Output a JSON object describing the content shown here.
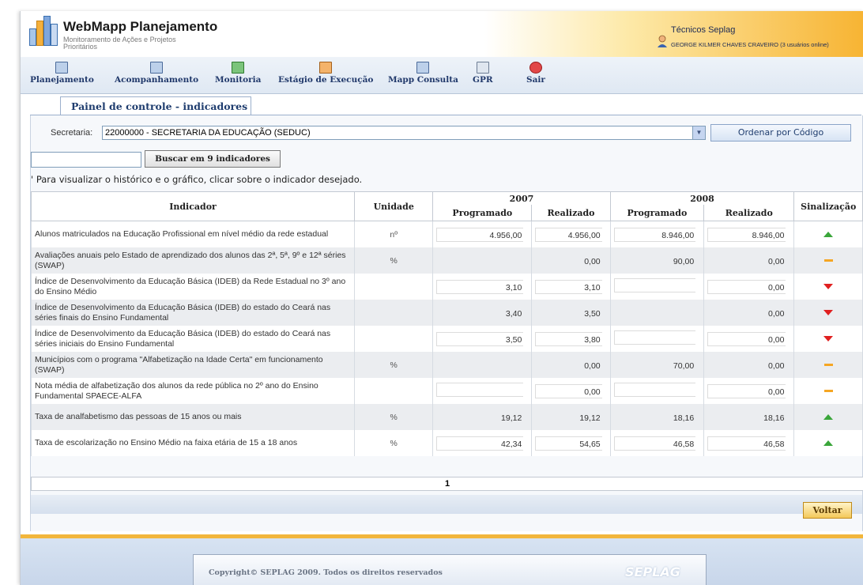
{
  "header": {
    "app_title": "WebMapp Planejamento",
    "app_subtitle": "Monitoramento de Ações e Projetos Prioritários",
    "user_role": "Técnicos Seplag",
    "user_name": "GEORGE KILMER CHAVES CRAVEIRO (3 usuários online)"
  },
  "nav": [
    {
      "label": "Planejamento",
      "icon": "planning-icon"
    },
    {
      "label": "Acompanhamento",
      "icon": "tracking-icon"
    },
    {
      "label": "Monitoria",
      "icon": "monitoring-icon"
    },
    {
      "label": "Estágio de Execução",
      "icon": "execution-icon"
    },
    {
      "label": "Mapp Consulta",
      "icon": "consult-icon"
    },
    {
      "label": "GPR",
      "icon": "gpr-icon"
    },
    {
      "label": "Sair",
      "icon": "exit-icon"
    }
  ],
  "tab": {
    "label": "Painel de controle - indicadores"
  },
  "filter": {
    "secretaria_label": "Secretaria:",
    "secretaria_value": "22000000 - SECRETARIA DA EDUCAÇÃO (SEDUC)",
    "order_button": "Ordenar por Código",
    "search_value": "",
    "search_button": "Buscar em 9 indicadores",
    "hint": "' Para visualizar o histórico e o gráfico, clicar sobre o indicador desejado."
  },
  "table": {
    "headers": {
      "indicador": "Indicador",
      "unidade": "Unidade",
      "year1": "2007",
      "year2": "2008",
      "programado": "Programado",
      "realizado": "Realizado",
      "sinalizacao": "Sinalização"
    },
    "rows": [
      {
        "indicador": "Alunos matriculados na Educação Profissional em nível médio da rede estadual",
        "unidade": "nº",
        "p2007": "4.956,00",
        "r2007": "4.956,00",
        "p2008": "8.946,00",
        "r2008": "8.946,00",
        "signal": "up"
      },
      {
        "indicador": "Avaliações anuais pelo Estado de aprendizado dos alunos das 2ª, 5ª, 9º e 12ª séries (SWAP)",
        "unidade": "%",
        "p2007": "",
        "r2007": "0,00",
        "p2008": "90,00",
        "r2008": "0,00",
        "signal": "neutral"
      },
      {
        "indicador": "Índice de Desenvolvimento da Educação Básica (IDEB) da Rede Estadual no 3º ano do Ensino Médio",
        "unidade": "",
        "p2007": "3,10",
        "r2007": "3,10",
        "p2008": "",
        "r2008": "0,00",
        "signal": "down"
      },
      {
        "indicador": "Índice de Desenvolvimento da Educação Básica (IDEB) do estado do Ceará nas séries finais do Ensino Fundamental",
        "unidade": "",
        "p2007": "3,40",
        "r2007": "3,50",
        "p2008": "",
        "r2008": "0,00",
        "signal": "down"
      },
      {
        "indicador": "Índice de Desenvolvimento da Educação Básica (IDEB) do estado do Ceará nas séries iniciais do Ensino Fundamental",
        "unidade": "",
        "p2007": "3,50",
        "r2007": "3,80",
        "p2008": "",
        "r2008": "0,00",
        "signal": "down"
      },
      {
        "indicador": "Municípios com o programa \"Alfabetização na Idade Certa\" em funcionamento (SWAP)",
        "unidade": "%",
        "p2007": "",
        "r2007": "0,00",
        "p2008": "70,00",
        "r2008": "0,00",
        "signal": "neutral"
      },
      {
        "indicador": "Nota média de alfabetização dos alunos da rede pública no 2º ano do Ensino Fundamental SPAECE-ALFA",
        "unidade": "",
        "p2007": "",
        "r2007": "0,00",
        "p2008": "",
        "r2008": "0,00",
        "signal": "neutral"
      },
      {
        "indicador": "Taxa de analfabetismo das pessoas de 15 anos ou mais",
        "unidade": "%",
        "p2007": "19,12",
        "r2007": "19,12",
        "p2008": "18,16",
        "r2008": "18,16",
        "signal": "up"
      },
      {
        "indicador": "Taxa de escolarização no Ensino Médio na faixa etária de 15 a 18 anos",
        "unidade": "%",
        "p2007": "42,34",
        "r2007": "54,65",
        "p2008": "46,58",
        "r2008": "46,58",
        "signal": "up"
      }
    ]
  },
  "pager": {
    "current": "1"
  },
  "actions": {
    "back_button": "Voltar"
  },
  "footer": {
    "copyright": "Copyright© SEPLAG 2009. Todos os direitos reservados",
    "brand": "SEPLAG"
  },
  "colors": {
    "signal_up": "#3aa63a",
    "signal_down": "#e02020",
    "signal_neutral": "#f5a623",
    "accent": "#f2b63c"
  }
}
